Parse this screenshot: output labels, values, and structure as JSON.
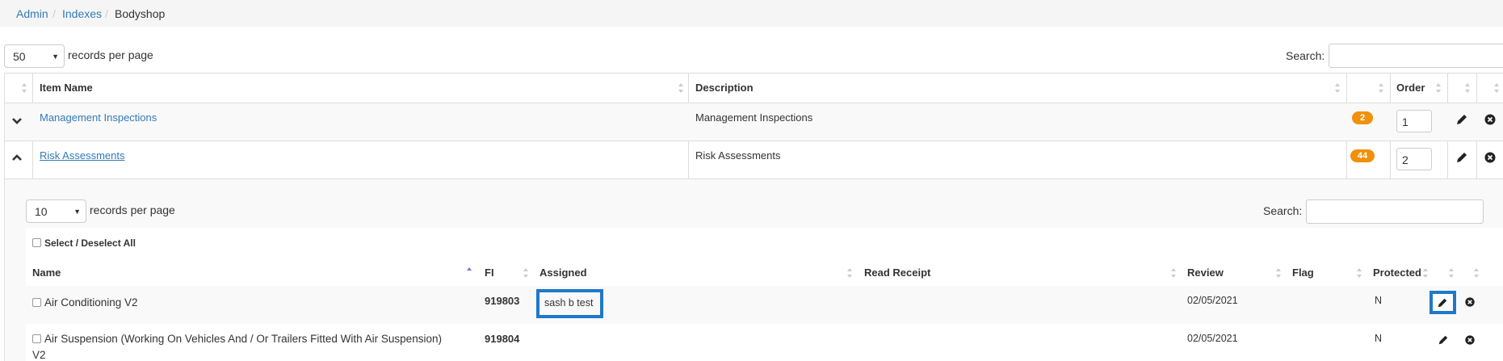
{
  "breadcrumb": {
    "admin": "Admin",
    "indexes": "Indexes",
    "current": "Bodyshop",
    "sep": "/"
  },
  "outer": {
    "per_page_value": "50",
    "per_page_label": "records per page",
    "search_label": "Search:",
    "columns": {
      "item_name": "Item Name",
      "description": "Description",
      "order": "Order"
    },
    "rows": [
      {
        "name": "Management Inspections",
        "description": "Management Inspections",
        "badge": "2",
        "order": "1"
      },
      {
        "name": "Risk Assessments",
        "description": "Risk Assessments",
        "badge": "44",
        "order": "2"
      }
    ]
  },
  "inner": {
    "per_page_value": "10",
    "per_page_label": "records per page",
    "search_label": "Search:",
    "select_all": "Select / Deselect All",
    "columns": {
      "name": "Name",
      "fi": "FI",
      "assigned": "Assigned",
      "read_receipt": "Read Receipt",
      "review": "Review",
      "flag": "Flag",
      "protected": "Protected"
    },
    "rows": [
      {
        "name": "Air Conditioning V2",
        "fi": "919803",
        "assigned": "sash b test",
        "review": "02/05/2021",
        "protected": "N"
      },
      {
        "name_line1": "Air Suspension (Working On Vehicles And / Or Trailers Fitted With Air Suspension)",
        "name_line2": "V2",
        "fi": "919804",
        "review": "02/05/2021",
        "protected": "N"
      }
    ]
  },
  "colors": {
    "link": "#337ab7",
    "badge": "#f0900b",
    "highlight": "#1f78c8"
  }
}
